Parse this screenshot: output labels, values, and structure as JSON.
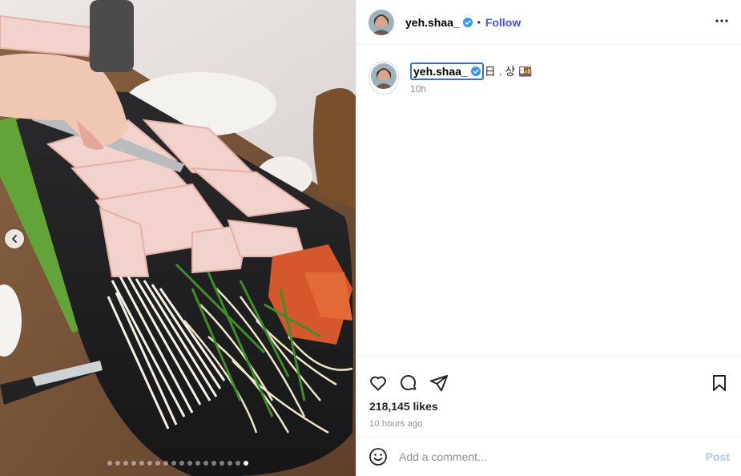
{
  "post": {
    "username": "yeh.shaa_",
    "verified": true,
    "separator": "•",
    "follow_label": "Follow",
    "more_icon": "more-horizontal-icon",
    "caption_text": "日 . 상 🍱",
    "caption_time": "10h",
    "likes": "218,145 likes",
    "posted_ago": "10 hours ago",
    "comment_placeholder": "Add a comment...",
    "post_label": "Post"
  },
  "media": {
    "description_icon": "carousel-photo",
    "slide_count": 18,
    "active_slide": 18
  },
  "colors": {
    "accent": "#4150f7",
    "verified": "#3797f0",
    "muted": "#8e8e8e",
    "divider": "#efefef"
  }
}
